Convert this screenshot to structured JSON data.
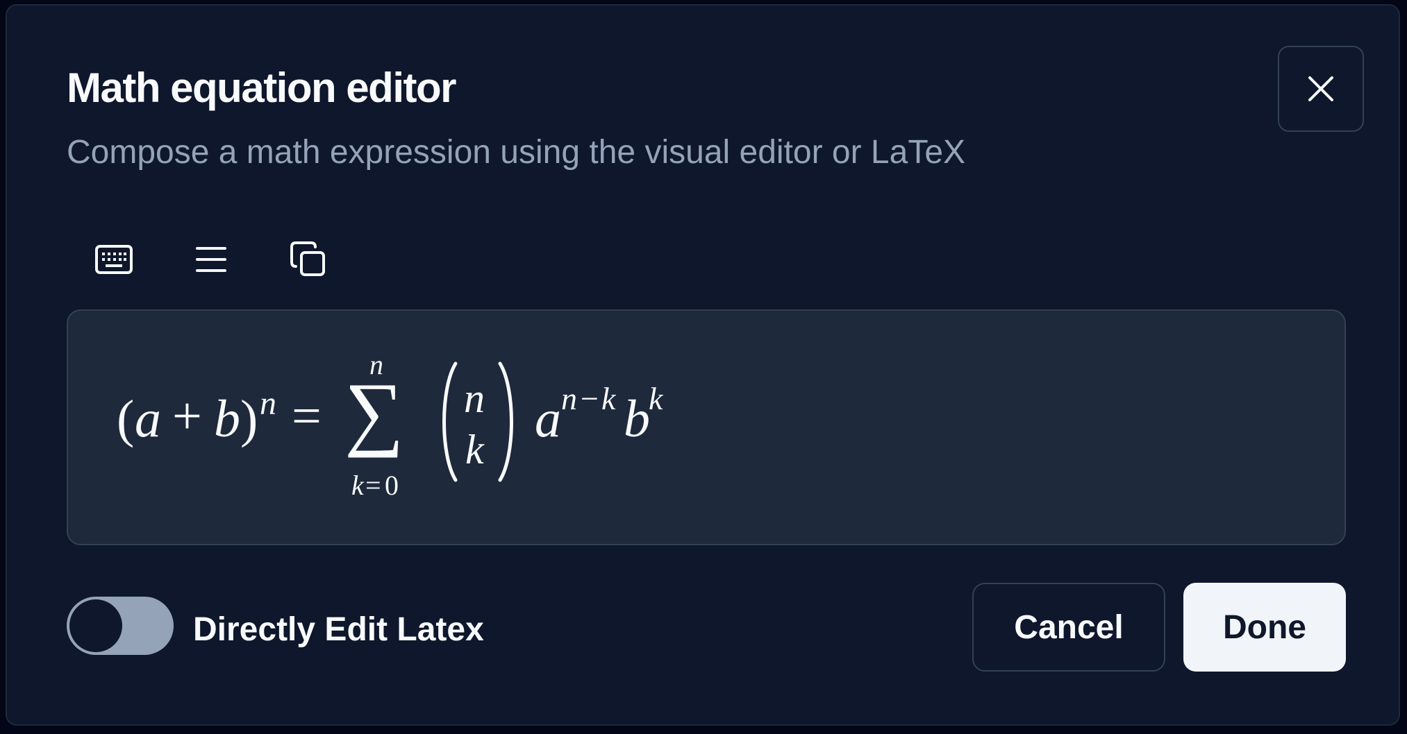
{
  "dialog": {
    "title": "Math equation editor",
    "subtitle": "Compose a math expression using the visual editor or LaTeX",
    "close_icon": "close-icon"
  },
  "toolbar": {
    "items": [
      {
        "icon": "keyboard-icon"
      },
      {
        "icon": "menu-icon"
      },
      {
        "icon": "copy-icon"
      }
    ]
  },
  "formula": {
    "lhs_open": "(",
    "lhs_a": "a",
    "lhs_plus": "+",
    "lhs_b": "b",
    "lhs_close": ")",
    "lhs_exp": "n",
    "equals": "=",
    "sum_symbol": "∑",
    "sum_upper": "n",
    "sum_lower_var": "k",
    "sum_lower_eq": "=",
    "sum_lower_val": "0",
    "binom_top": "n",
    "binom_bottom": "k",
    "term_a": "a",
    "term_a_exp_n": "n",
    "term_a_exp_minus": "−",
    "term_a_exp_k": "k",
    "term_b": "b",
    "term_b_exp": "k"
  },
  "toggle": {
    "label": "Directly Edit Latex",
    "checked": false
  },
  "actions": {
    "cancel_label": "Cancel",
    "done_label": "Done"
  },
  "colors": {
    "background": "#0e172b",
    "panel": "#1e293b",
    "border": "#334155",
    "text": "#f8fafc",
    "muted": "#94a3b8",
    "primary_button": "#f1f5f9"
  }
}
